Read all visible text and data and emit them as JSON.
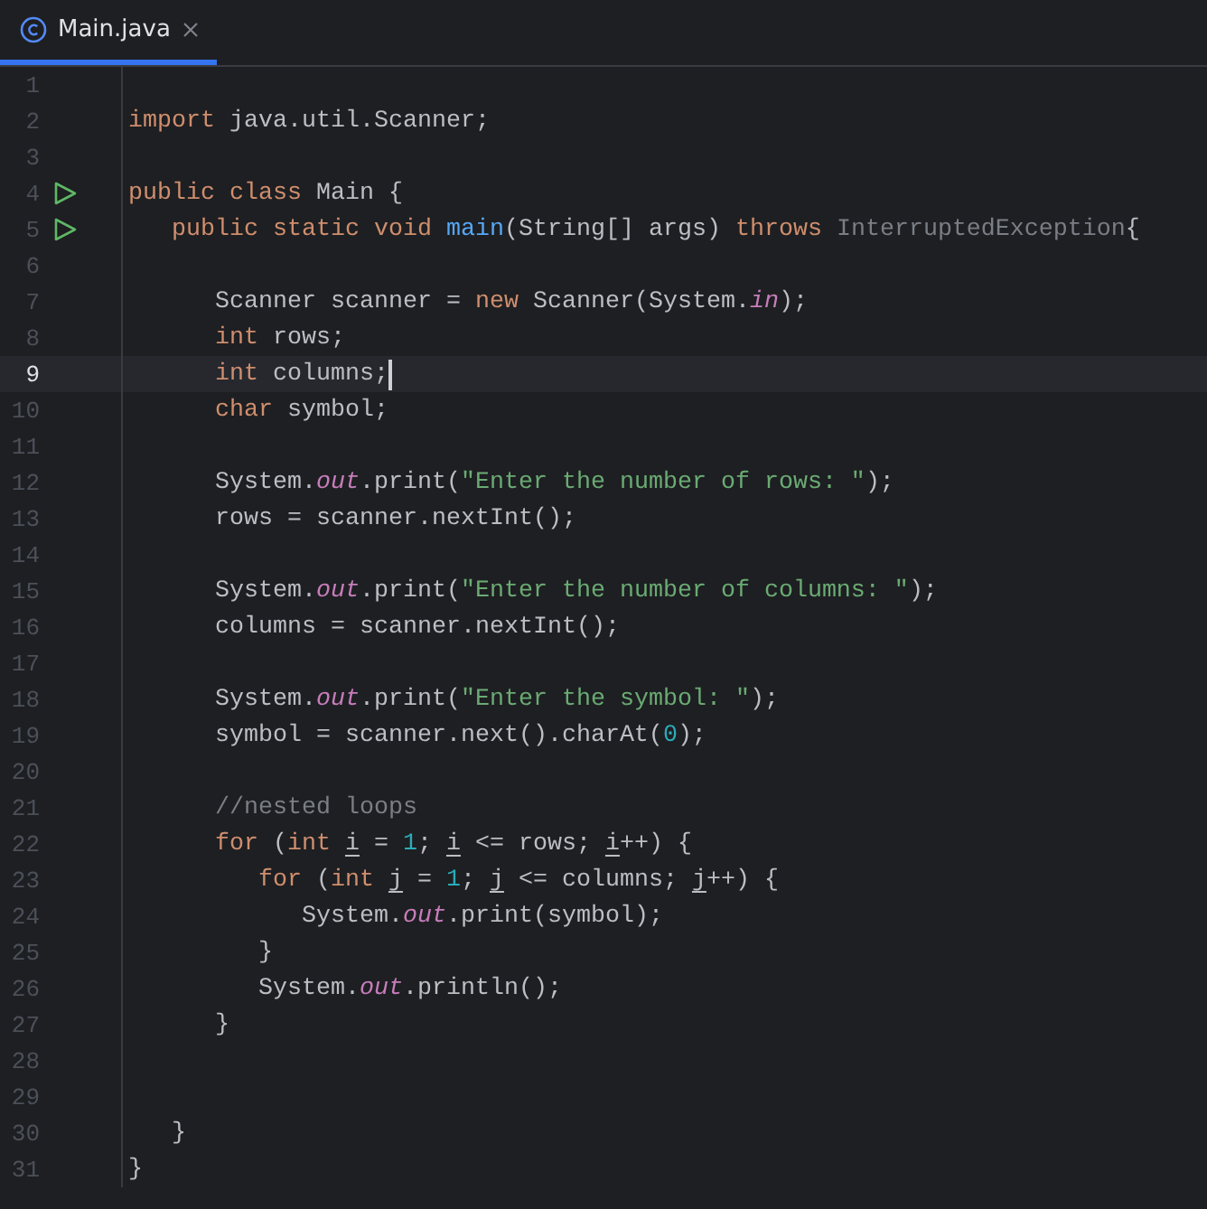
{
  "tab": {
    "label": "Main.java",
    "selected": true
  },
  "lines": [
    {
      "number": "1",
      "runnable": false,
      "current": false
    },
    {
      "number": "2",
      "runnable": false,
      "current": false,
      "tokens": [
        {
          "kind": "keyword",
          "text": "import"
        },
        {
          "kind": "plain",
          "text": " java.util.Scanner;"
        }
      ]
    },
    {
      "number": "3",
      "runnable": false,
      "current": false
    },
    {
      "number": "4",
      "runnable": true,
      "current": false,
      "tokens": [
        {
          "kind": "keyword",
          "text": "public class"
        },
        {
          "kind": "plain",
          "text": " Main {"
        }
      ]
    },
    {
      "number": "5",
      "runnable": true,
      "current": false,
      "tokens": [
        {
          "kind": "keyword",
          "text": "   public static void "
        },
        {
          "kind": "method",
          "text": "main"
        },
        {
          "kind": "plain",
          "text": "(String[] args) "
        },
        {
          "kind": "keyword",
          "text": "throws "
        },
        {
          "kind": "unused",
          "text": "InterruptedException"
        },
        {
          "kind": "plain",
          "text": "{"
        }
      ]
    },
    {
      "number": "6",
      "runnable": false,
      "current": false
    },
    {
      "number": "7",
      "runnable": false,
      "current": false,
      "tokens": [
        {
          "kind": "plain",
          "text": "      Scanner scanner = "
        },
        {
          "kind": "keyword",
          "text": "new"
        },
        {
          "kind": "plain",
          "text": " Scanner(System."
        },
        {
          "kind": "field",
          "text": "in"
        },
        {
          "kind": "plain",
          "text": ");"
        }
      ]
    },
    {
      "number": "8",
      "runnable": false,
      "current": false,
      "tokens": [
        {
          "kind": "keyword",
          "text": "      int"
        },
        {
          "kind": "plain",
          "text": " rows;"
        }
      ]
    },
    {
      "number": "9",
      "runnable": false,
      "current": true,
      "tokens": [
        {
          "kind": "keyword",
          "text": "      int"
        },
        {
          "kind": "plain",
          "text": " columns;"
        }
      ]
    },
    {
      "number": "10",
      "runnable": false,
      "current": false,
      "tokens": [
        {
          "kind": "keyword",
          "text": "      char"
        },
        {
          "kind": "plain",
          "text": " symbol;"
        }
      ]
    },
    {
      "number": "11",
      "runnable": false,
      "current": false
    },
    {
      "number": "12",
      "runnable": false,
      "current": false,
      "tokens": [
        {
          "kind": "plain",
          "text": "      System."
        },
        {
          "kind": "field",
          "text": "out"
        },
        {
          "kind": "plain",
          "text": ".print("
        },
        {
          "kind": "string",
          "text": "\"Enter the number of rows: \""
        },
        {
          "kind": "plain",
          "text": ");"
        }
      ]
    },
    {
      "number": "13",
      "runnable": false,
      "current": false,
      "tokens": [
        {
          "kind": "plain",
          "text": "      rows = scanner.nextInt();"
        }
      ]
    },
    {
      "number": "14",
      "runnable": false,
      "current": false
    },
    {
      "number": "15",
      "runnable": false,
      "current": false,
      "tokens": [
        {
          "kind": "plain",
          "text": "      System."
        },
        {
          "kind": "field",
          "text": "out"
        },
        {
          "kind": "plain",
          "text": ".print("
        },
        {
          "kind": "string",
          "text": "\"Enter the number of columns: \""
        },
        {
          "kind": "plain",
          "text": ");"
        }
      ]
    },
    {
      "number": "16",
      "runnable": false,
      "current": false,
      "tokens": [
        {
          "kind": "plain",
          "text": "      columns = scanner.nextInt();"
        }
      ]
    },
    {
      "number": "17",
      "runnable": false,
      "current": false
    },
    {
      "number": "18",
      "runnable": false,
      "current": false,
      "tokens": [
        {
          "kind": "plain",
          "text": "      System."
        },
        {
          "kind": "field",
          "text": "out"
        },
        {
          "kind": "plain",
          "text": ".print("
        },
        {
          "kind": "string",
          "text": "\"Enter the symbol: \""
        },
        {
          "kind": "plain",
          "text": ");"
        }
      ]
    },
    {
      "number": "19",
      "runnable": false,
      "current": false,
      "tokens": [
        {
          "kind": "plain",
          "text": "      symbol = scanner.next().charAt("
        },
        {
          "kind": "number",
          "text": "0"
        },
        {
          "kind": "plain",
          "text": ");"
        }
      ]
    },
    {
      "number": "20",
      "runnable": false,
      "current": false
    },
    {
      "number": "21",
      "runnable": false,
      "current": false,
      "tokens": [
        {
          "kind": "comment",
          "text": "      //nested loops"
        }
      ]
    },
    {
      "number": "22",
      "runnable": false,
      "current": false,
      "tokens": [
        {
          "kind": "keyword",
          "text": "      for"
        },
        {
          "kind": "plain",
          "text": " ("
        },
        {
          "kind": "keyword",
          "text": "int "
        },
        {
          "kind": "variable",
          "text": "i"
        },
        {
          "kind": "plain",
          "text": " = "
        },
        {
          "kind": "number",
          "text": "1"
        },
        {
          "kind": "plain",
          "text": "; "
        },
        {
          "kind": "variable",
          "text": "i"
        },
        {
          "kind": "plain",
          "text": " <= rows; "
        },
        {
          "kind": "variable",
          "text": "i"
        },
        {
          "kind": "plain",
          "text": "++) {"
        }
      ]
    },
    {
      "number": "23",
      "runnable": false,
      "current": false,
      "tokens": [
        {
          "kind": "keyword",
          "text": "         for"
        },
        {
          "kind": "plain",
          "text": " ("
        },
        {
          "kind": "keyword",
          "text": "int "
        },
        {
          "kind": "variable",
          "text": "j"
        },
        {
          "kind": "plain",
          "text": " = "
        },
        {
          "kind": "number",
          "text": "1"
        },
        {
          "kind": "plain",
          "text": "; "
        },
        {
          "kind": "variable",
          "text": "j"
        },
        {
          "kind": "plain",
          "text": " <= columns; "
        },
        {
          "kind": "variable",
          "text": "j"
        },
        {
          "kind": "plain",
          "text": "++) {"
        }
      ]
    },
    {
      "number": "24",
      "runnable": false,
      "current": false,
      "tokens": [
        {
          "kind": "plain",
          "text": "            System."
        },
        {
          "kind": "field",
          "text": "out"
        },
        {
          "kind": "plain",
          "text": ".print(symbol);"
        }
      ]
    },
    {
      "number": "25",
      "runnable": false,
      "current": false,
      "tokens": [
        {
          "kind": "plain",
          "text": "         }"
        }
      ]
    },
    {
      "number": "26",
      "runnable": false,
      "current": false,
      "tokens": [
        {
          "kind": "plain",
          "text": "         System."
        },
        {
          "kind": "field",
          "text": "out"
        },
        {
          "kind": "plain",
          "text": ".println();"
        }
      ]
    },
    {
      "number": "27",
      "runnable": false,
      "current": false,
      "tokens": [
        {
          "kind": "plain",
          "text": "      }"
        }
      ]
    },
    {
      "number": "28",
      "runnable": false,
      "current": false
    },
    {
      "number": "29",
      "runnable": false,
      "current": false
    },
    {
      "number": "30",
      "runnable": false,
      "current": false,
      "tokens": [
        {
          "kind": "plain",
          "text": "   }"
        }
      ]
    },
    {
      "number": "31",
      "runnable": false,
      "current": false,
      "tokens": [
        {
          "kind": "plain",
          "text": "}"
        }
      ]
    }
  ]
}
